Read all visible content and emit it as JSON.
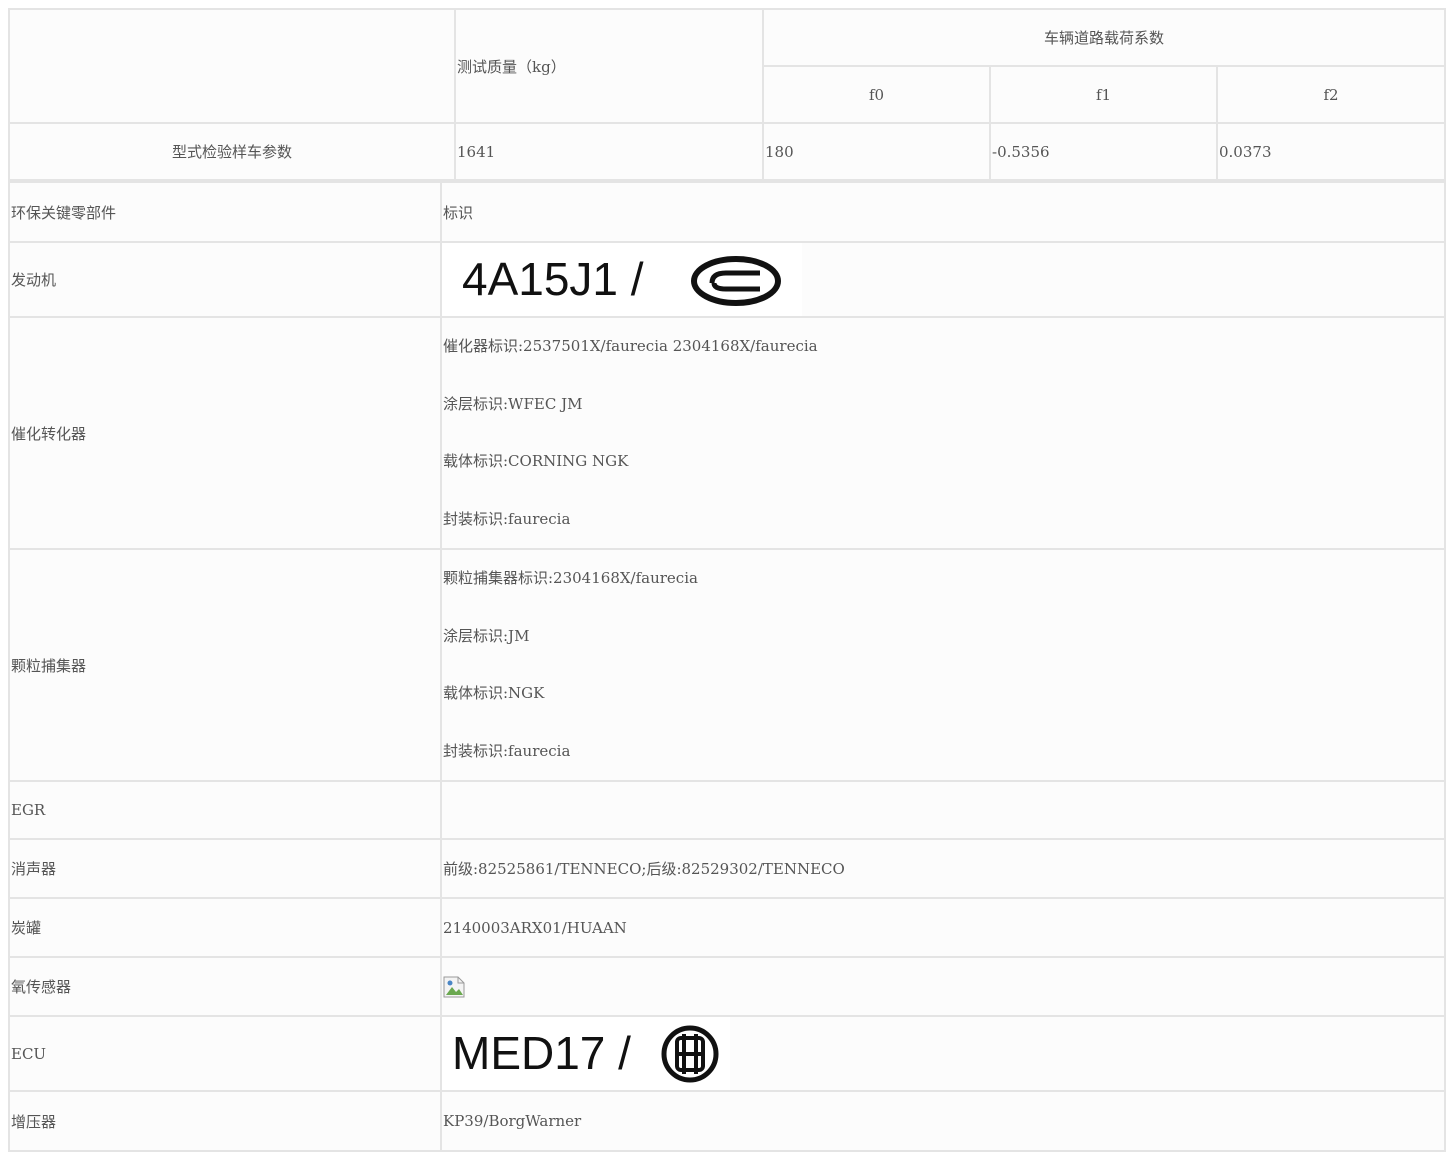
{
  "params_table": {
    "header_empty": "",
    "test_mass_label": "测试质量（kg）",
    "coefficients_label": "车辆道路载荷系数",
    "f0_label": "f0",
    "f1_label": "f1",
    "f2_label": "f2",
    "row_label": "型式检验样车参数",
    "test_mass": "1641",
    "f0": "180",
    "f1": "-0.5356",
    "f2": "0.0373"
  },
  "parts_table": {
    "header_part": "环保关键零部件",
    "header_mark": "标识",
    "engine": {
      "label": "发动机",
      "logo_text": "4A15J1 /"
    },
    "catalyst": {
      "label": "催化转化器",
      "lines": [
        "催化器标识:2537501X/faurecia 2304168X/faurecia",
        "涂层标识:WFEC JM",
        "载体标识:CORNING NGK",
        "封装标识:faurecia"
      ]
    },
    "particulate": {
      "label": "颗粒捕集器",
      "lines": [
        "颗粒捕集器标识:2304168X/faurecia",
        "涂层标识:JM",
        "载体标识:NGK",
        "封装标识:faurecia"
      ]
    },
    "egr": {
      "label": "EGR",
      "value": ""
    },
    "muffler": {
      "label": "消声器",
      "value": "前级:82525861/TENNECO;后级:82529302/TENNECO"
    },
    "canister": {
      "label": "炭罐",
      "value": "2140003ARX01/HUAAN"
    },
    "oxygen_sensor": {
      "label": "氧传感器"
    },
    "ecu": {
      "label": "ECU",
      "logo_text": "MED17 /"
    },
    "turbo": {
      "label": "增压器",
      "value": "KP39/BorgWarner"
    }
  }
}
